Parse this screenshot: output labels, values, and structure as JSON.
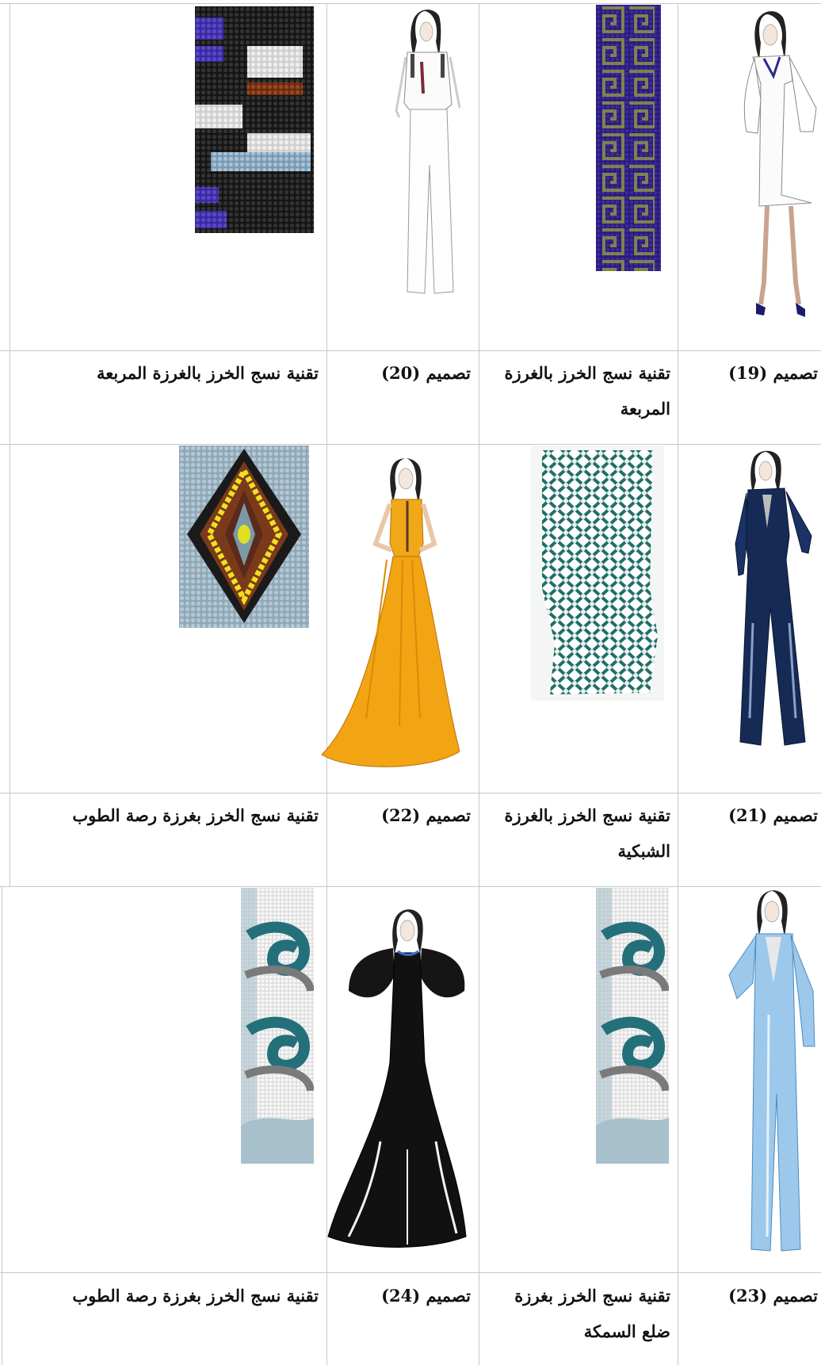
{
  "rows": [
    {
      "design_a": "تصميم (19)",
      "technique_a": "تقنية نسج الخرز بالغرزة المربعة",
      "design_b": "تصميم (20)",
      "technique_b": "تقنية نسج الخرز بالغرزة المربعة"
    },
    {
      "design_a": "تصميم (21)",
      "technique_a": "تقنية نسج الخرز بالغرزة الشبكية",
      "design_b": "تصميم (22)",
      "technique_b": "تقنية نسج الخرز بغرزة رصة الطوب"
    },
    {
      "design_a": "تصميم (23)",
      "technique_a": "تقنية نسج الخرز بغرزة ضلع السمكة",
      "design_b": "تصميم (24)",
      "technique_b": "تقنية نسج الخرز بغرزة رصة الطوب"
    }
  ]
}
